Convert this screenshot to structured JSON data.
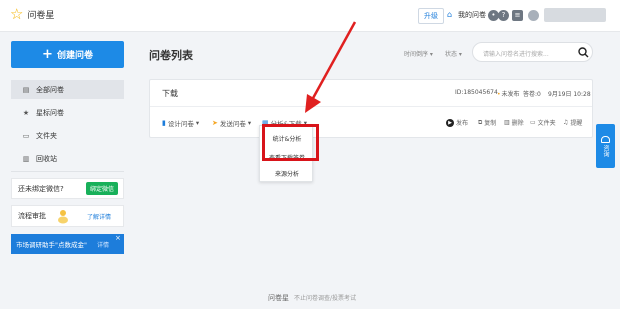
{
  "header": {
    "logo_text": "问卷星",
    "upgrade_label": "升级",
    "my_surveys_label": "我的问卷",
    "icons": [
      "bell-icon",
      "help-icon",
      "message-icon"
    ]
  },
  "sidebar": {
    "create_label": "创建问卷",
    "items": [
      {
        "label": "全部问卷",
        "icon": "document-icon"
      },
      {
        "label": "星标问卷",
        "icon": "star-icon"
      },
      {
        "label": "文件夹",
        "icon": "folder-icon"
      },
      {
        "label": "回收站",
        "icon": "trash-icon"
      }
    ],
    "wechat_text": "还未绑定微信?",
    "wechat_button": "绑定微信",
    "flow_text": "流程审批",
    "flow_link": "了解详情",
    "banner_text": "市场调研助手\"点数成金\"",
    "banner_detail": "详情",
    "banner_close": "×"
  },
  "main": {
    "title": "问卷列表",
    "sort_time": "时间倒序",
    "sort_status": "状态",
    "search_placeholder": "请输入问卷名进行搜索..."
  },
  "survey_card": {
    "title": "下载",
    "id_text": "ID:185045674",
    "status": "未发布",
    "answers": "答卷:0",
    "date": "9月19日 10:28",
    "actions": {
      "design": "设计问卷",
      "send": "发送问卷",
      "analyze": "分析&下载"
    },
    "right_actions": {
      "publish": "发布",
      "copy": "复制",
      "delete": "删除",
      "folder": "文件夹",
      "remind": "提醒"
    }
  },
  "dropdown": {
    "items": [
      "统计&分析",
      "查看下载答卷",
      "来源分析"
    ]
  },
  "float_button": {
    "label": "咨询"
  },
  "footer": {
    "brand": "问卷星",
    "slogan": "不止问卷调查/投票考试"
  },
  "colors": {
    "accent": "#1d8ae6",
    "highlight": "#d8141a",
    "wechat_green": "#18b05a"
  }
}
